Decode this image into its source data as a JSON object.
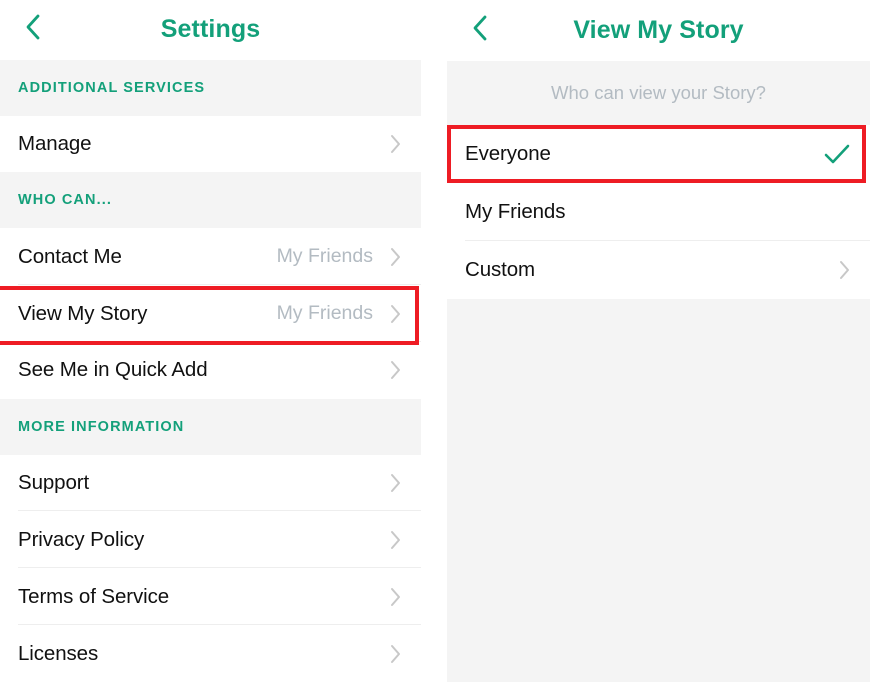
{
  "colors": {
    "accent_green": "#13a07a",
    "highlight_red": "#ee1c24",
    "muted_text": "#b3bbc2",
    "section_bg": "#f4f4f4",
    "row_text": "#111111"
  },
  "left_panel": {
    "navbar": {
      "back_icon": "chevron-left-icon",
      "title": "Settings"
    },
    "sections": [
      {
        "header": "ADDITIONAL SERVICES",
        "rows": [
          {
            "label": "Manage",
            "value": "",
            "accessory": "chevron-right-icon"
          }
        ]
      },
      {
        "header": "WHO CAN...",
        "rows": [
          {
            "label": "Contact Me",
            "value": "My Friends",
            "accessory": "chevron-right-icon"
          },
          {
            "label": "View My Story",
            "value": "My Friends",
            "accessory": "chevron-right-icon"
          },
          {
            "label": "See Me in Quick Add",
            "value": "",
            "accessory": "chevron-right-icon"
          }
        ]
      },
      {
        "header": "MORE INFORMATION",
        "rows": [
          {
            "label": "Support",
            "value": "",
            "accessory": "chevron-right-icon"
          },
          {
            "label": "Privacy Policy",
            "value": "",
            "accessory": "chevron-right-icon"
          },
          {
            "label": "Terms of Service",
            "value": "",
            "accessory": "chevron-right-icon"
          },
          {
            "label": "Licenses",
            "value": "",
            "accessory": "chevron-right-icon"
          }
        ]
      }
    ],
    "highlighted_row": "View My Story"
  },
  "right_panel": {
    "navbar": {
      "back_icon": "chevron-left-icon",
      "title": "View My Story"
    },
    "prompt": "Who can view your Story?",
    "options": [
      {
        "label": "Everyone",
        "accessory": "check-icon",
        "selected": true
      },
      {
        "label": "My Friends",
        "accessory": "none",
        "selected": false
      },
      {
        "label": "Custom",
        "accessory": "chevron-right-icon",
        "selected": false
      }
    ],
    "highlighted_option": "Everyone"
  }
}
